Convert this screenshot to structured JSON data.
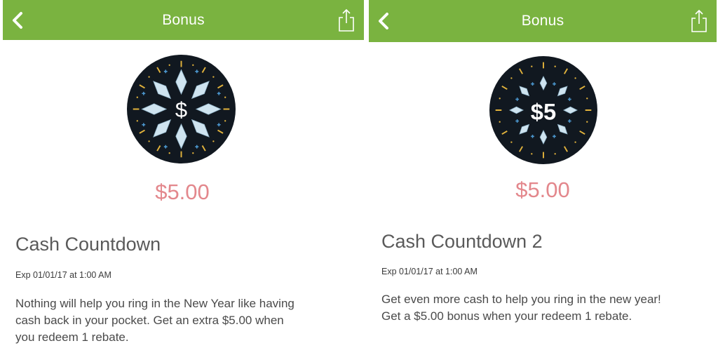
{
  "colors": {
    "topbar": "#7ab340",
    "amount": "#e3878c",
    "badge_background": "#111820",
    "badge_star": "#cfe4f0",
    "badge_dash": "#e2b33c",
    "badge_cross": "#4c98d0"
  },
  "screens": [
    {
      "topbar": {
        "back_icon": "chevron-left-icon",
        "title": "Bonus",
        "share_icon": "share-icon"
      },
      "badge": {
        "label": "$"
      },
      "amount": "$5.00",
      "title": "Cash Countdown",
      "expiry": "Exp 01/01/17 at 1:00 AM",
      "description_lines": [
        "Nothing will help you ring in the New Year like having",
        "cash back in your pocket. Get an extra $5.00 when",
        "you redeem 1 rebate."
      ]
    },
    {
      "topbar": {
        "back_icon": "chevron-left-icon",
        "title": "Bonus",
        "share_icon": "share-icon"
      },
      "badge": {
        "label": "$5"
      },
      "amount": "$5.00",
      "title": "Cash Countdown 2",
      "expiry": "Exp 01/01/17 at 1:00 AM",
      "description_lines": [
        "Get even more cash to help you ring in the new year!",
        "Get a $5.00 bonus when your redeem 1 rebate."
      ]
    }
  ]
}
